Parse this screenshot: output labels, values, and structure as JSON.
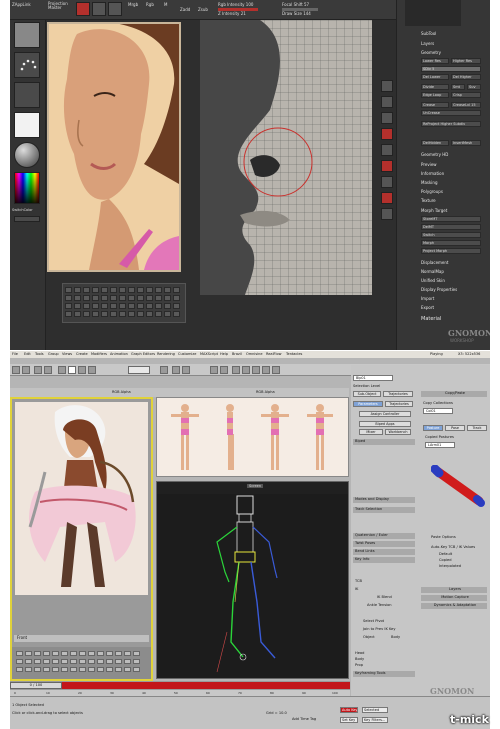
{
  "zbrush": {
    "top_labels": [
      "ZAppLink",
      "Projection Master",
      "Mrgb",
      "Rgb",
      "M",
      "Zadd",
      "Zsub",
      "Rgb Intensity 100",
      "Z Intensity 21",
      "Focal Shift 57",
      "Draw Size 144"
    ],
    "color_label": "SwitchColor",
    "menu_items": [
      "SubTool",
      "Layers",
      "Geometry",
      "Geometry HD",
      "Preview",
      "Information",
      "Masking",
      "Polygroups",
      "Texture",
      "Morph Target",
      "Displacement",
      "NormalMap",
      "Unified Skin",
      "Display Properties",
      "Import",
      "Export",
      "Material"
    ],
    "geometry_buttons": [
      "Lower Res",
      "Higher Res",
      "SDiv 5",
      "Del Lower",
      "Del Higher",
      "Divide",
      "Smt",
      "Suv",
      "Edge Loop",
      "Crisp",
      "Crease",
      "CreaseLvl 15",
      "UnCrease",
      "ReProject Higher Subdiv",
      "DelHidden",
      "InsertMesh"
    ],
    "morph_buttons": [
      "StoreMT",
      "DelMT",
      "Switch",
      "Morph",
      "Project Morph"
    ],
    "logo": "GNOMON",
    "logo_sub": "WORKSHOP"
  },
  "max": {
    "menu": [
      "File",
      "Edit",
      "Tools",
      "Group",
      "Views",
      "Create",
      "Modifiers",
      "Animation",
      "Graph Editors",
      "Rendering",
      "Customize",
      "MAXScript",
      "Help",
      "Brazil",
      "Omnisine",
      "RealFlow",
      "Tentacles"
    ],
    "title_status": "Playing",
    "title_cursor": "X3: 522x536",
    "viewport_concept_mode": "RGB Alpha",
    "viewport_concept_label": "Front",
    "viewport_ref_mode": "RGB Alpha",
    "viewport_persp_mode": "Screen",
    "right_panel": {
      "object_name": "Bip01",
      "selection_level": "Selection Level",
      "subobject": "Sub-Object",
      "trajectories": "Trajectories",
      "tabs": [
        "Parameters",
        "Trajectories"
      ],
      "buttons": [
        "Assign Controller",
        "Biped Apps",
        "Mixer",
        "Workbench"
      ],
      "sections": [
        "Biped",
        "Track Selection",
        "Modes and Display",
        "Quaternion / Euler",
        "Twist Poses",
        "Bend Links",
        "Key Info",
        "Keyframing Tools"
      ],
      "fields": [
        "TCB",
        "IK",
        "Head",
        "Body",
        "Prop"
      ],
      "labels": [
        "IK Blend",
        "Ankle Tension",
        "Select Pivot",
        "Join to Prev IK Key",
        "Object",
        "Body"
      ],
      "copy_paste": "Copy/Paste",
      "copy_collections": "Copy Collections",
      "collection_name": "Col01",
      "copy_tabs": [
        "Posture",
        "Pose",
        "Track"
      ],
      "copied_postures": "Copied Postures",
      "posture_name": "LArm01",
      "paste_options": "Paste Options",
      "paste_from": "Auto-Key TCB / IK Values",
      "paste_radio": [
        "Default",
        "Copied",
        "Interpolated"
      ],
      "layers": "Layers",
      "motion_capture": "Motion Capture",
      "dynamics": "Dynamics & Adaptation"
    },
    "timeline_slider": "0 / 100",
    "ruler": [
      "0",
      "10",
      "20",
      "30",
      "40",
      "50",
      "60",
      "70",
      "80",
      "90",
      "100"
    ],
    "status": {
      "selected": "1 Object Selected",
      "prompt": "Click or click-and-drag to select objects",
      "grid": "Grid = 10.0",
      "add_time_tag": "Add Time Tag",
      "auto_key": "Auto Key",
      "selected_dropdown": "Selected",
      "set_key": "Set Key",
      "key_filters": "Key Filters..."
    },
    "logo": "GNOMON",
    "logo_sub": "WORKSHOP"
  },
  "watermark": "t-mick"
}
